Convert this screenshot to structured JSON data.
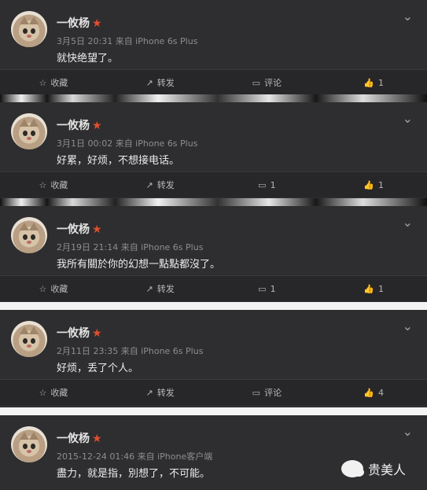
{
  "posts": [
    {
      "user_name": "一攸杨",
      "meta": "3月5日 20:31 来自 iPhone 6s Plus",
      "text": "就快绝望了。",
      "collect": "收藏",
      "forward": "转发",
      "comment": "评论",
      "like": "1"
    },
    {
      "user_name": "一攸杨",
      "meta": "3月1日 00:02 来自 iPhone 6s Plus",
      "text": "好累，好烦，不想接电话。",
      "collect": "收藏",
      "forward": "转发",
      "comment": "1",
      "like": "1"
    },
    {
      "user_name": "一攸杨",
      "meta": "2月19日 21:14 来自 iPhone 6s Plus",
      "text": "我所有關於你的幻想一點點都沒了。",
      "collect": "收藏",
      "forward": "转发",
      "comment": "1",
      "like": "1"
    },
    {
      "user_name": "一攸杨",
      "meta": "2月11日 23:35 来自 iPhone 6s Plus",
      "text": "好烦，丢了个人。",
      "collect": "收藏",
      "forward": "转发",
      "comment": "评论",
      "like": "4"
    },
    {
      "user_name": "一攸杨",
      "meta": "2015-12-24 01:46 来自 iPhone客户端",
      "text": "盡力，就是指，別想了，不可能。"
    }
  ],
  "watermark": {
    "label": "贵美人"
  }
}
